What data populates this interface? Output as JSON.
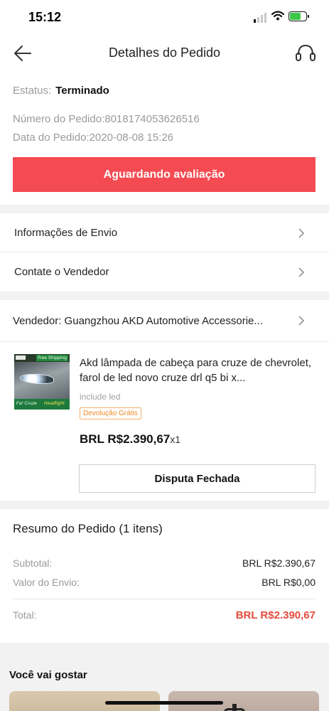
{
  "status_bar": {
    "time": "15:12"
  },
  "nav": {
    "title": "Detalhes do Pedido"
  },
  "order": {
    "status_label": "Estatus:",
    "status_value": "Terminado",
    "number": "Número do Pedido:8018174053626516",
    "date": "Data do Pedido:2020-08-08 15:26",
    "review_button": "Aguardando avaliação"
  },
  "links": {
    "shipping": "Informações de Envio",
    "contact": "Contate o Vendedor"
  },
  "seller": {
    "name": "Vendedor: Guangzhou AKD Automotive Accessorie..."
  },
  "product": {
    "title": "Akd lâmpada de cabeça para cruze de chevrolet, farol de led novo cruze drl q5 bi x...",
    "variant": "include led",
    "badge": "Devolução Grátis",
    "price": "BRL R$2.390,67",
    "quantity": "x1",
    "dispute_button": "Disputa Fechada",
    "image_texts": {
      "shipping": "Free Shipping",
      "model": "For Cruze",
      "type": "Headlight"
    }
  },
  "summary": {
    "title": "Resumo do Pedido (1 itens)",
    "subtotal_label": "Subtotal:",
    "subtotal_value": "BRL R$2.390,67",
    "shipping_label": "Valor do Envio:",
    "shipping_value": "BRL R$0,00",
    "total_label": "Total:",
    "total_value": "BRL R$2.390,67"
  },
  "recommend": {
    "title": "Você vai gostar"
  },
  "colors": {
    "accent": "#f44b52",
    "total": "#e54a3c",
    "badge": "#f08a24",
    "battery": "#3cc74b"
  },
  "icons": [
    "back-arrow-icon",
    "headset-icon",
    "chevron-right-icon",
    "wifi-icon",
    "battery-icon",
    "signal-icon"
  ]
}
